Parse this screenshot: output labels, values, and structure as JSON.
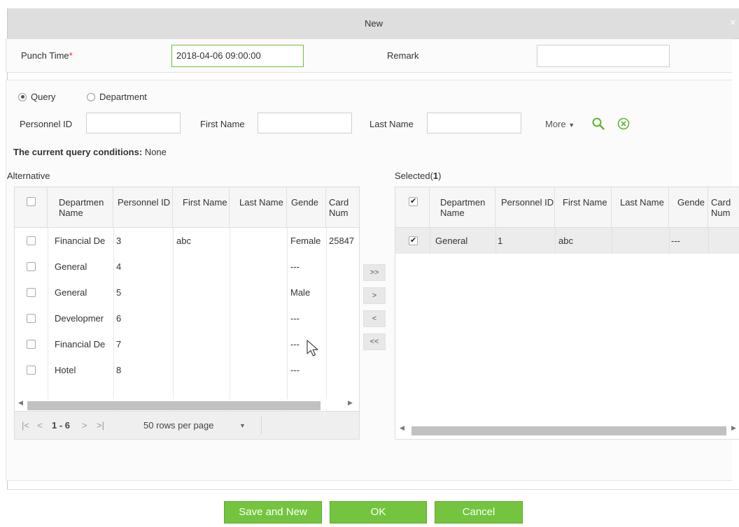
{
  "dialog": {
    "title": "New",
    "close_glyph": "×"
  },
  "form": {
    "punch_time_label": "Punch Time",
    "required_mark": "*",
    "punch_time_value": "2018-04-06 09:00:00",
    "remark_label": "Remark",
    "remark_value": ""
  },
  "query": {
    "mode_query": "Query",
    "mode_department": "Department",
    "selected_mode": "Query",
    "personnel_id_label": "Personnel ID",
    "first_name_label": "First Name",
    "last_name_label": "Last Name",
    "more_label": "More",
    "conditions_label": "The current query conditions:",
    "conditions_value": "None"
  },
  "alternative": {
    "title": "Alternative",
    "columns": [
      "Departmen Name",
      "Personnel ID",
      "First Name",
      "Last Name",
      "Gende",
      "Card Num"
    ],
    "rows": [
      {
        "dept": "Financial De",
        "id": "3",
        "first": "abc",
        "last": "",
        "gender": "Female",
        "card": "25847"
      },
      {
        "dept": "General",
        "id": "4",
        "first": "",
        "last": "",
        "gender": "---",
        "card": ""
      },
      {
        "dept": "General",
        "id": "5",
        "first": "",
        "last": "",
        "gender": "Male",
        "card": ""
      },
      {
        "dept": "Developmer",
        "id": "6",
        "first": "",
        "last": "",
        "gender": "---",
        "card": ""
      },
      {
        "dept": "Financial De",
        "id": "7",
        "first": "",
        "last": "",
        "gender": "---",
        "card": ""
      },
      {
        "dept": "Hotel",
        "id": "8",
        "first": "",
        "last": "",
        "gender": "---",
        "card": ""
      }
    ],
    "pager": {
      "first": "|<",
      "prev": "<",
      "range": "1 - 6",
      "next": ">",
      "last": ">|",
      "rows_per_page": "50 rows per page"
    }
  },
  "selected": {
    "title_prefix": "Selected(",
    "count": "1",
    "title_suffix": ")",
    "columns": [
      "Departmen Name",
      "Personnel ID",
      "First Name",
      "Last Name",
      "Gende",
      "Card Num"
    ],
    "rows": [
      {
        "dept": "General",
        "id": "1",
        "first": "abc",
        "last": "",
        "gender": "---",
        "card": ""
      }
    ]
  },
  "move_buttons": {
    "add_all": ">>",
    "add": ">",
    "remove": "<",
    "remove_all": "<<"
  },
  "footer": {
    "save_new": "Save and New",
    "ok": "OK",
    "cancel": "Cancel"
  },
  "colors": {
    "accent_green": "#74c43f",
    "title_bar": "#dedede",
    "required": "#ee2222"
  }
}
